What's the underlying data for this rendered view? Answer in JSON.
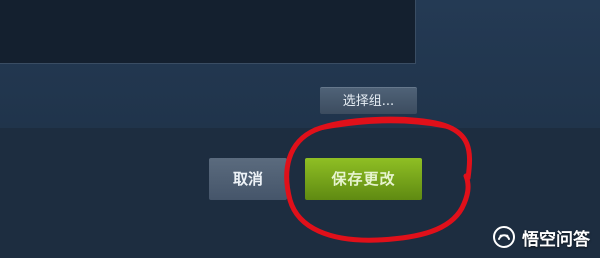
{
  "dialog": {
    "select_group_label": "选择组...",
    "cancel_label": "取消",
    "save_changes_label": "保存更改"
  },
  "watermark": {
    "text": "悟空问答",
    "icon": "wukong-logo-icon"
  },
  "colors": {
    "background": "#1e2f42",
    "save_button": "#7aa81d",
    "annotation": "#e0101a"
  }
}
